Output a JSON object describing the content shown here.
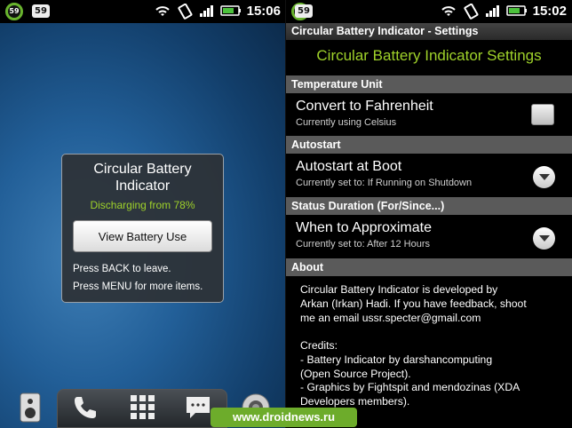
{
  "left": {
    "status": {
      "battery_ring": "59",
      "badge": "59",
      "time": "15:06"
    },
    "dialog": {
      "title_line1": "Circular Battery",
      "title_line2": "Indicator",
      "status": "Discharging from 78%",
      "button": "View Battery Use",
      "hint1": "Press BACK to leave.",
      "hint2": "Press MENU for more items."
    },
    "dock": [
      "speaker-icon",
      "phone-icon",
      "app-grid-icon",
      "message-icon",
      "camera-icon"
    ]
  },
  "right": {
    "status": {
      "battery_ring": "59",
      "badge": "59",
      "time": "15:02"
    },
    "window_title": "Circular Battery Indicator - Settings",
    "heading": "Circular Battery Indicator Settings",
    "sections": {
      "temperature": {
        "header": "Temperature Unit",
        "title": "Convert to Fahrenheit",
        "summary": "Currently using Celsius"
      },
      "autostart": {
        "header": "Autostart",
        "title": "Autostart at Boot",
        "summary": "Currently set to: If Running on Shutdown"
      },
      "status_duration": {
        "header": "Status Duration (For/Since...)",
        "title": "When to Approximate",
        "summary": "Currently set to: After 12 Hours"
      },
      "about": {
        "header": "About",
        "p1_l1": "Circular Battery Indicator is developed by",
        "p1_l2": "Arkan (Irkan) Hadi. If you have feedback, shoot",
        "p1_l3": "me an email ussr.specter@gmail.com",
        "credits_header": "Credits:",
        "c1_l1": "- Battery Indicator by darshancomputing",
        "c1_l2": "(Open Source Project).",
        "c2_l1": "- Graphics by Fightspit and mendozinas (XDA",
        "c2_l2": "Developers members)."
      }
    }
  },
  "watermark": "www.droidnews.ru",
  "colors": {
    "accent_green": "#9fd22a",
    "category_bg": "#5a5a5a",
    "watermark_bg": "#6dac2b"
  }
}
